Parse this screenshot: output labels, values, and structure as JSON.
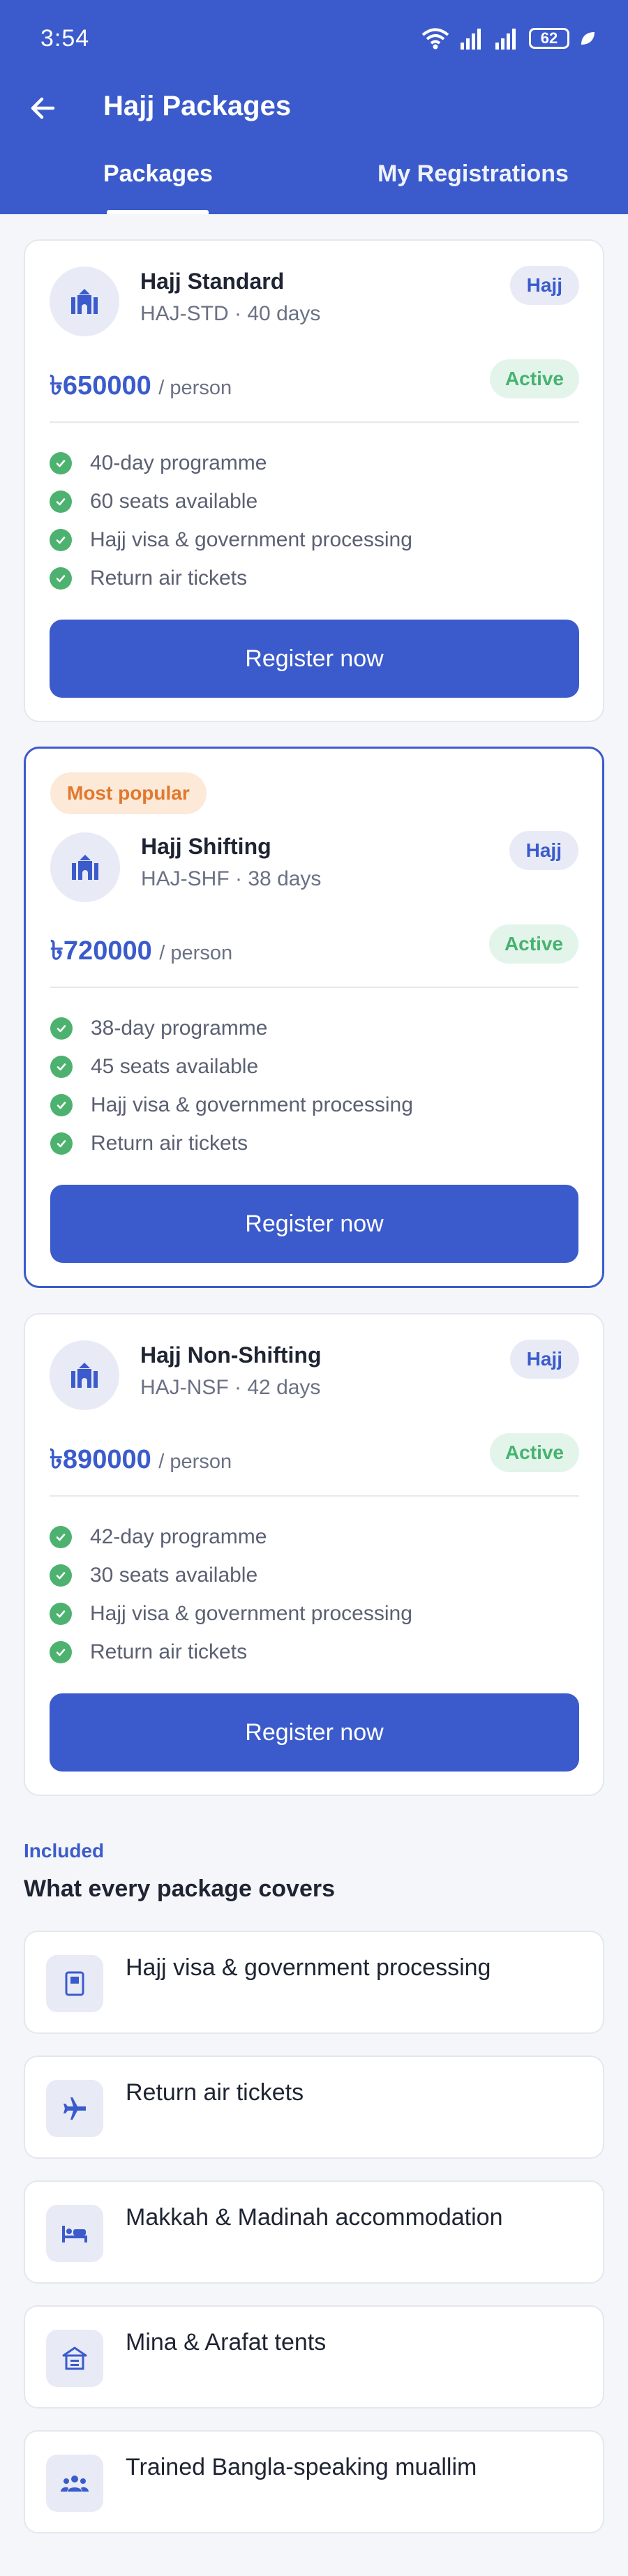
{
  "status_bar": {
    "time": "3:54",
    "battery": "62"
  },
  "header": {
    "title": "Hajj Packages"
  },
  "tabs": [
    {
      "label": "Packages",
      "active": true
    },
    {
      "label": "My Registrations",
      "active": false
    }
  ],
  "packages": [
    {
      "name": "Hajj Standard",
      "code": "HAJ-STD",
      "separator": "·",
      "duration": "40 days",
      "type": "Hajj",
      "price": "৳650000",
      "per": "/ person",
      "status": "Active",
      "features": [
        "40-day programme",
        "60 seats available",
        "Hajj visa & government processing",
        "Return air tickets"
      ],
      "button": "Register now"
    },
    {
      "badge": "Most popular",
      "name": "Hajj Shifting",
      "code": "HAJ-SHF",
      "separator": "·",
      "duration": "38 days",
      "type": "Hajj",
      "price": "৳720000",
      "per": "/ person",
      "status": "Active",
      "features": [
        "38-day programme",
        "45 seats available",
        "Hajj visa & government processing",
        "Return air tickets"
      ],
      "button": "Register now"
    },
    {
      "name": "Hajj Non-Shifting",
      "code": "HAJ-NSF",
      "separator": "·",
      "duration": "42 days",
      "type": "Hajj",
      "price": "৳890000",
      "per": "/ person",
      "status": "Active",
      "features": [
        "42-day programme",
        "30 seats available",
        "Hajj visa & government processing",
        "Return air tickets"
      ],
      "button": "Register now"
    }
  ],
  "included": {
    "kicker": "Included",
    "title": "What every package covers",
    "items": [
      {
        "label": "Hajj visa & government processing",
        "icon": "passport-icon"
      },
      {
        "label": "Return air tickets",
        "icon": "airplane-icon"
      },
      {
        "label": "Makkah & Madinah accommodation",
        "icon": "bed-icon"
      },
      {
        "label": "Mina & Arafat tents",
        "icon": "tent-icon"
      },
      {
        "label": "Trained Bangla-speaking muallim",
        "icon": "group-icon"
      }
    ]
  },
  "colors": {
    "primary": "#3b5bcc",
    "success": "#45b36f",
    "badge": "#e0782e"
  }
}
